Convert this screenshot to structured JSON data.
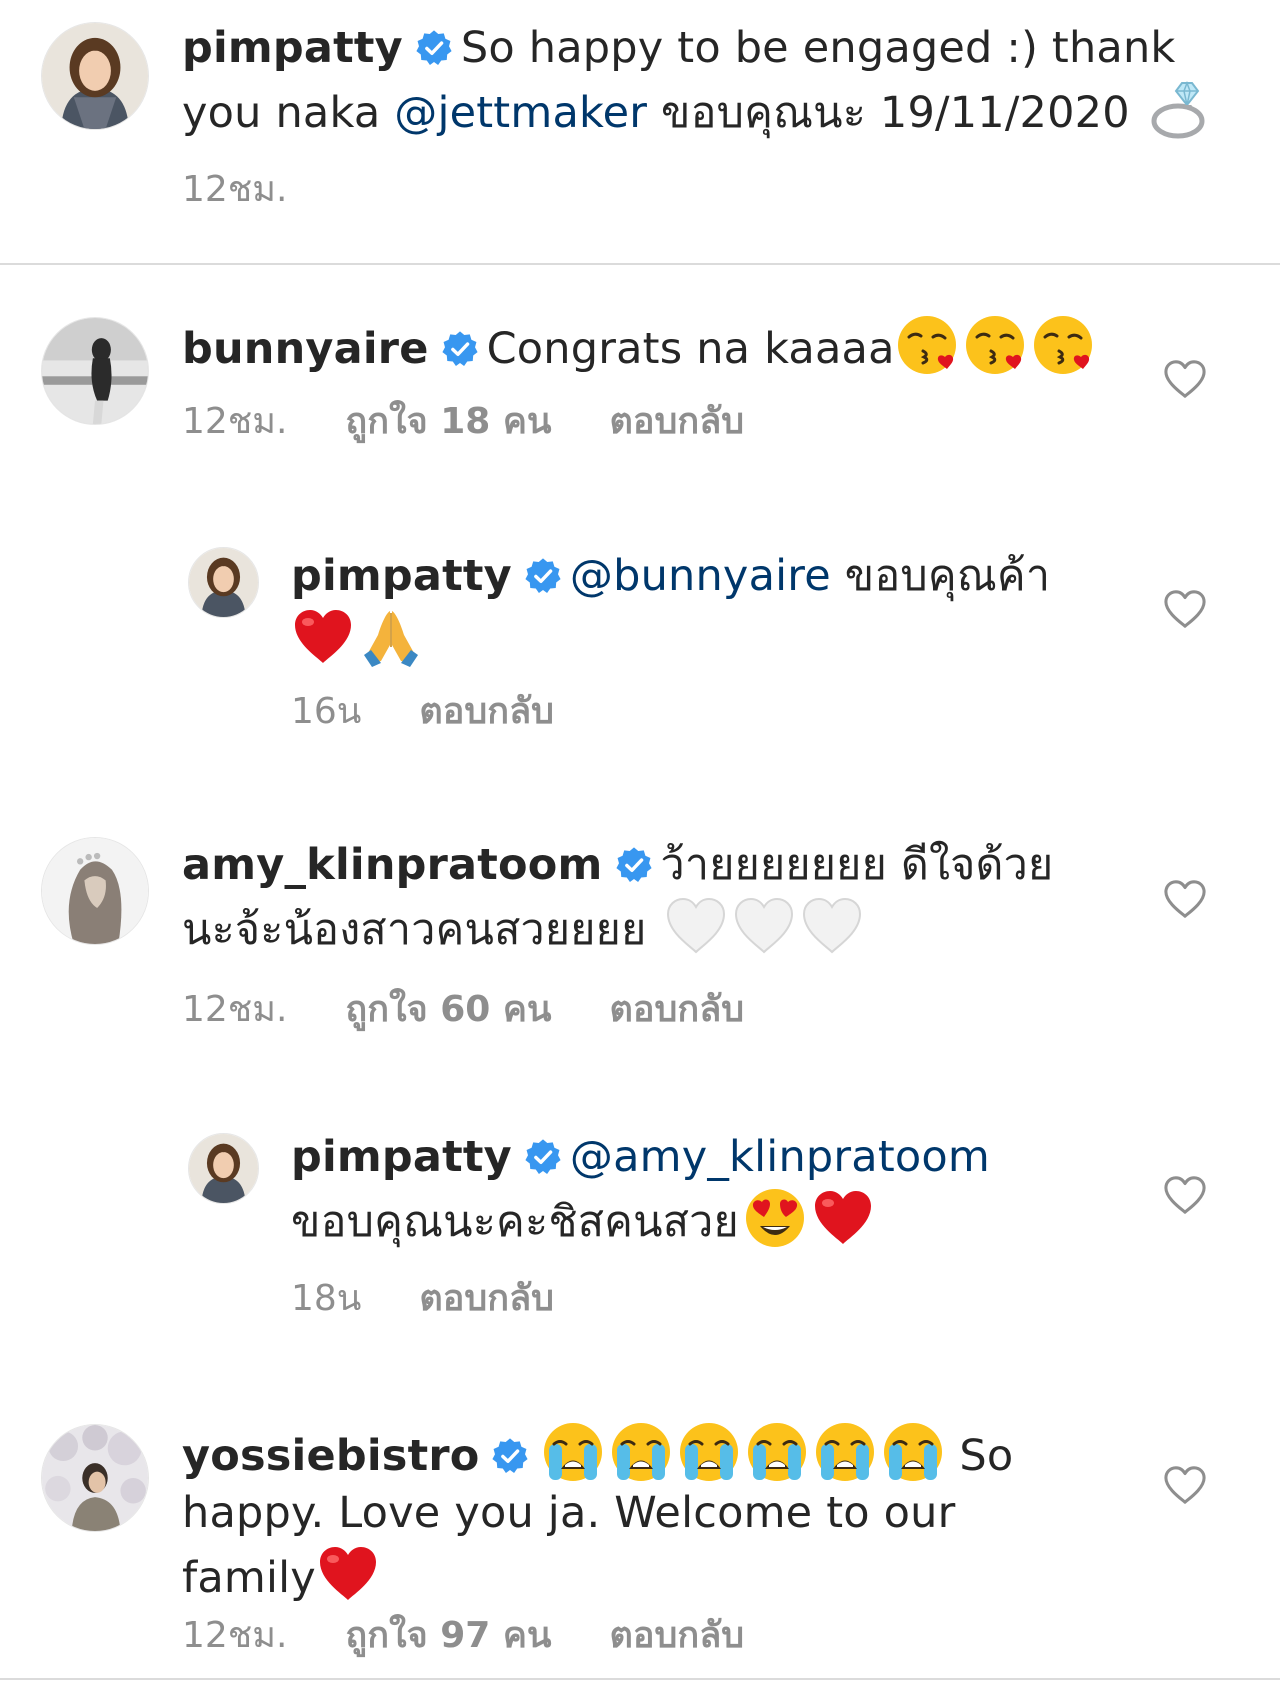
{
  "caption": {
    "username": "pimpatty",
    "line1": "So happy to be engaged :) thank",
    "line2_pre": "you naka ",
    "mention": "@jettmaker",
    "line2_post": " ขอบคุณนะ  19/11/2020 ",
    "time": "12ชม."
  },
  "c1": {
    "username": "bunnyaire",
    "text": "Congrats na kaaaa",
    "time": "12ชม.",
    "likes": "ถูกใจ 18 คน",
    "reply": "ตอบกลับ"
  },
  "r1": {
    "username": "pimpatty",
    "mention": "@bunnyaire",
    "text": " ขอบคุณค้า",
    "time": "16น",
    "reply": "ตอบกลับ"
  },
  "c2": {
    "username": "amy_klinpratoom",
    "line1": "ว้ายยยยยยย ดีใจด้วย",
    "line2": "นะจ้ะน้องสาวคนสวยยยย ",
    "time": "12ชม.",
    "likes": "ถูกใจ 60 คน",
    "reply": "ตอบกลับ"
  },
  "r2": {
    "username": "pimpatty",
    "mention": "@amy_klinpratoom",
    "line2": "ขอบคุณนะคะชิสคนสวย",
    "time": "18น",
    "reply": "ตอบกลับ"
  },
  "c3": {
    "username": "yossiebistro",
    "line1_post": " So",
    "line2": "happy. Love you ja. Welcome to our",
    "line3": "family",
    "time": "12ชม.",
    "likes": "ถูกใจ 97 คน",
    "reply": "ตอบกลับ"
  },
  "colors": {
    "verified": "#3897f0",
    "mention": "#00376b",
    "meta": "#8e8e8e",
    "divider": "#dbdbdb",
    "heart_red": "#e0141e"
  },
  "icons": [
    "verified-badge-icon",
    "heart-outline-icon",
    "ring-emoji",
    "kissing-face-emoji",
    "red-heart-emoji",
    "praying-hands-emoji",
    "white-heart-emoji",
    "heart-eyes-emoji",
    "crying-face-emoji"
  ]
}
